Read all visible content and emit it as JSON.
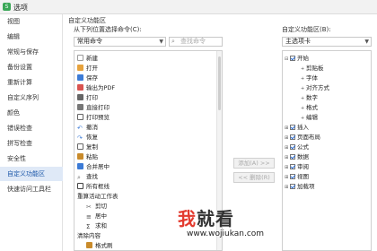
{
  "window": {
    "title": "选项",
    "app_icon_text": "S"
  },
  "sidebar": {
    "items": [
      {
        "label": "视图"
      },
      {
        "label": "编辑"
      },
      {
        "label": "常规与保存"
      },
      {
        "label": "备份设置"
      },
      {
        "label": "重新计算"
      },
      {
        "label": "自定义序列"
      },
      {
        "label": "颜色"
      },
      {
        "label": "错误检查"
      },
      {
        "label": "拼写检查"
      },
      {
        "label": "安全性"
      },
      {
        "label": "自定义功能区"
      },
      {
        "label": "快速访问工具栏"
      }
    ],
    "active_index": 10
  },
  "main": {
    "section_title": "自定义功能区",
    "left_label": "从下列位置选择命令(C):",
    "left_select": "常用命令",
    "search_placeholder": "查找命令",
    "commands": [
      {
        "label": "新建",
        "icon": "new-doc-icon",
        "color": "#9a9a9a"
      },
      {
        "label": "打开",
        "icon": "folder-icon",
        "color": "#e6a23c"
      },
      {
        "label": "保存",
        "icon": "save-icon",
        "color": "#3c7bd6"
      },
      {
        "label": "输出为PDF",
        "icon": "pdf-icon",
        "color": "#d9534f"
      },
      {
        "label": "打印",
        "icon": "print-icon",
        "color": "#666666"
      },
      {
        "label": "直接打印",
        "icon": "quick-print-icon",
        "color": "#666666"
      },
      {
        "label": "打印预览",
        "icon": "print-preview-icon",
        "color": "#666666"
      },
      {
        "label": "撤消",
        "icon": "undo-icon",
        "color": "#3c7bd6"
      },
      {
        "label": "恢复",
        "icon": "redo-icon",
        "color": "#3c7bd6"
      },
      {
        "label": "复制",
        "icon": "copy-icon",
        "color": "#666666"
      },
      {
        "label": "粘贴",
        "icon": "paste-icon",
        "color": "#c98b2b"
      },
      {
        "label": "合并居中",
        "icon": "merge-center-icon",
        "color": "#3c7bd6"
      },
      {
        "label": "查找",
        "icon": "find-icon",
        "color": "#666666"
      },
      {
        "label": "所有框线",
        "icon": "borders-icon",
        "color": "#444444"
      },
      {
        "label": "重算活动工作表",
        "icon": "",
        "color": ""
      },
      {
        "label": "剪切",
        "icon": "cut-icon",
        "color": "#666666"
      },
      {
        "label": "居中",
        "icon": "align-center-icon",
        "color": "#444444"
      },
      {
        "label": "求和",
        "icon": "sum-icon",
        "color": "#444444"
      },
      {
        "label": "清除内容",
        "icon": "",
        "color": ""
      },
      {
        "label": "格式刷",
        "icon": "format-painter-icon",
        "color": "#c98b2b"
      }
    ],
    "add_button": "添加(A) >>",
    "remove_button": "<< 删除(R)",
    "right_label": "自定义功能区(B):",
    "right_select": "主选项卡",
    "tree": [
      {
        "label": "开始",
        "checked": true,
        "expanded": true,
        "level": 0
      },
      {
        "label": "剪贴板",
        "level": 1
      },
      {
        "label": "字体",
        "level": 1
      },
      {
        "label": "对齐方式",
        "level": 1
      },
      {
        "label": "数字",
        "level": 1
      },
      {
        "label": "格式",
        "level": 1
      },
      {
        "label": "编辑",
        "level": 1
      },
      {
        "label": "插入",
        "checked": true,
        "expanded": false,
        "level": 0
      },
      {
        "label": "页面布局",
        "checked": true,
        "expanded": false,
        "level": 0
      },
      {
        "label": "公式",
        "checked": true,
        "expanded": false,
        "level": 0
      },
      {
        "label": "数据",
        "checked": true,
        "expanded": false,
        "level": 0
      },
      {
        "label": "审阅",
        "checked": true,
        "expanded": false,
        "level": 0
      },
      {
        "label": "视图",
        "checked": true,
        "expanded": false,
        "level": 0
      },
      {
        "label": "加载项",
        "checked": true,
        "expanded": false,
        "level": 0
      }
    ]
  },
  "watermark": {
    "text_red": "我",
    "text_dark": "就看",
    "url": "www.wojiukan.com"
  }
}
